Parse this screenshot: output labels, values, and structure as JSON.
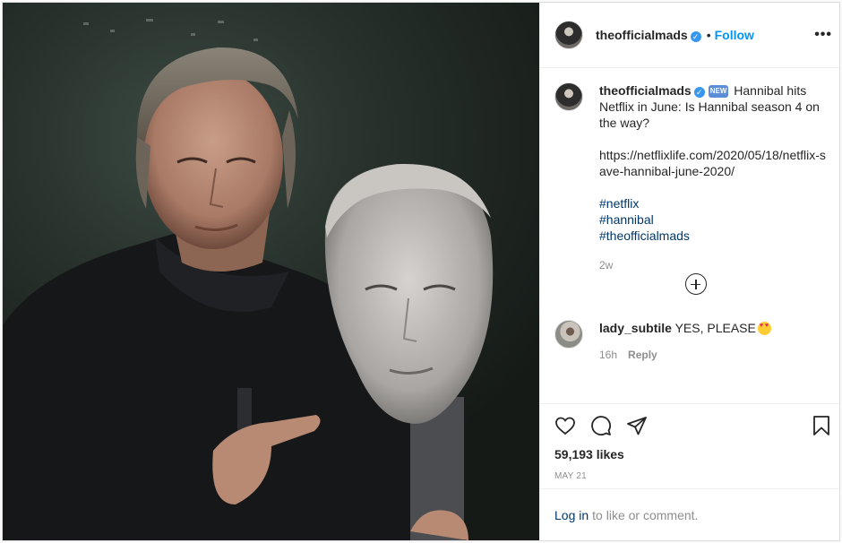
{
  "header": {
    "username": "theofficialmads",
    "separator": "•",
    "follow_label": "Follow",
    "more_label": "•••"
  },
  "caption": {
    "username": "theofficialmads",
    "badge": "NEW",
    "text": "Hannibal hits Netflix in June: Is Hannibal season 4 on the way?",
    "link": "https://netflixlife.com/2020/05/18/netflix-save-hannibal-june-2020/",
    "hashtags": [
      "#netflix",
      "#hannibal",
      "#theofficialmads"
    ],
    "timestamp": "2w"
  },
  "comment": {
    "username": "lady_subtile",
    "text": "YES, PLEASE",
    "emoji": "heart-eyes-emoji",
    "timestamp": "16h",
    "reply_label": "Reply"
  },
  "actions": {
    "likes": "59,193 likes",
    "date": "MAY 21"
  },
  "login": {
    "link_label": "Log in",
    "text": "to like or comment."
  },
  "colors": {
    "follow": "#0095f6",
    "hashtag": "#00376b",
    "verified": "#3897f0",
    "muted": "#8e8e8e"
  }
}
